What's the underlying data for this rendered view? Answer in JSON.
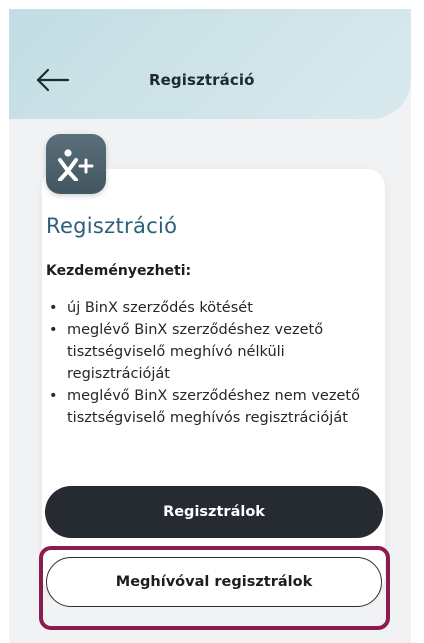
{
  "header": {
    "back_icon": "arrow-left-icon",
    "title": "Regisztráció"
  },
  "card": {
    "icon": "person-plus-icon",
    "title": "Regisztráció",
    "section_label": "Kezdeményezheti:",
    "bullets": [
      "új BinX szerződés kötését",
      "meglévő BinX szerződéshez vezető tisztségviselő meghívó nélküli regisztrációját",
      "meglévő BinX szerződéshez nem vezető tisztségviselő meghívós regisztrációját"
    ],
    "primary_button": "Regisztrálok",
    "secondary_button": "Meghívóval regisztrálok"
  },
  "colors": {
    "header_bg": "#cfe4e9",
    "title_color": "#2b5f7c",
    "primary_button_bg": "#252b30",
    "highlight_border": "#8c1c4e",
    "icon_bg": "#4b5f69"
  }
}
